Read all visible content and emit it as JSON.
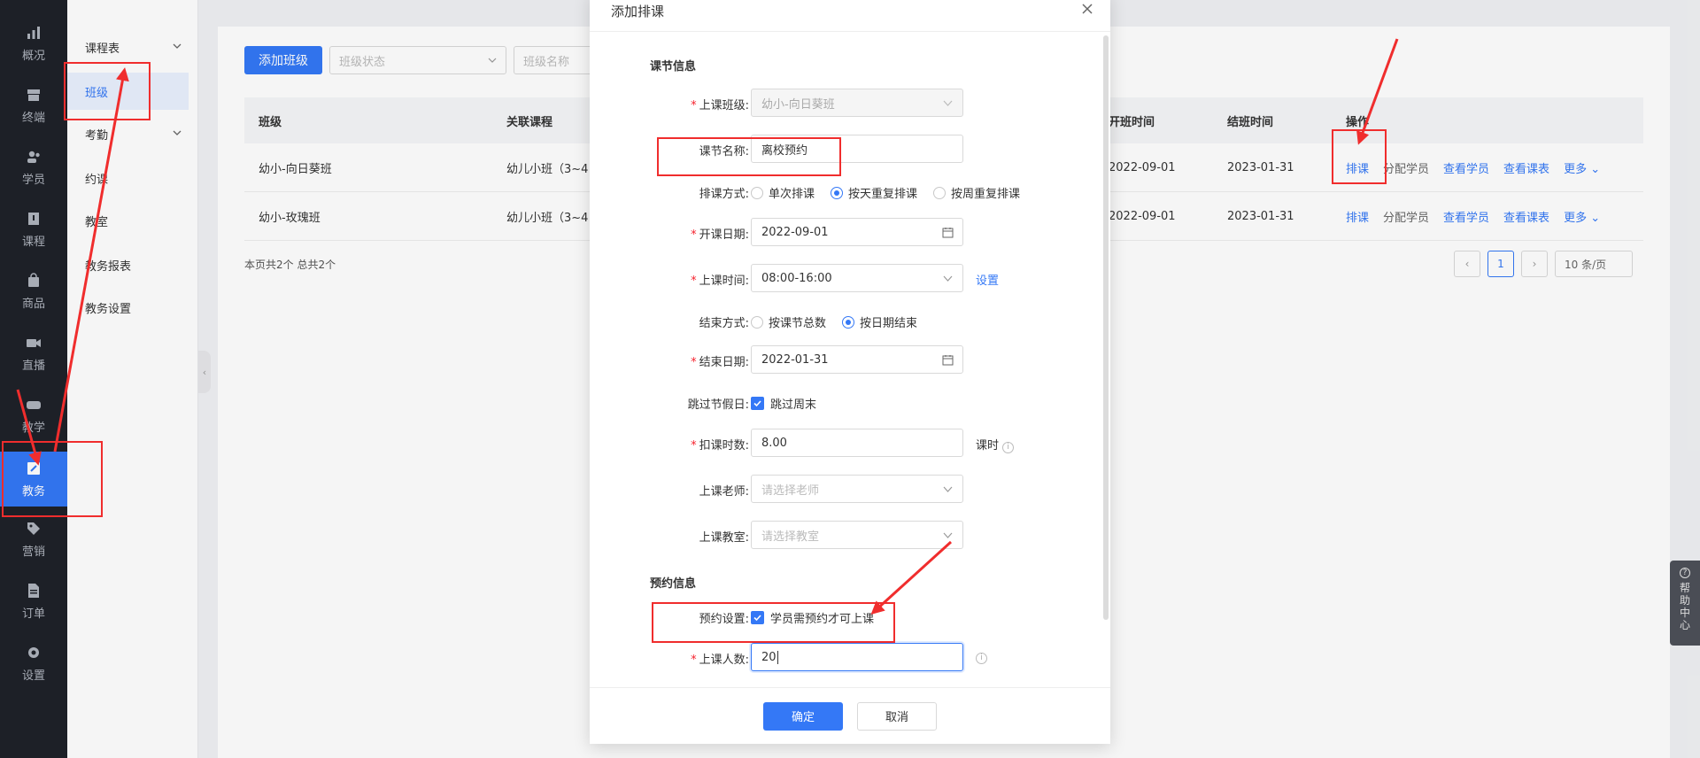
{
  "rail": {
    "items": [
      {
        "label": "概况",
        "icon": "chart-icon"
      },
      {
        "label": "终端",
        "icon": "shop-icon"
      },
      {
        "label": "学员",
        "icon": "users-icon"
      },
      {
        "label": "课程",
        "icon": "book-icon"
      },
      {
        "label": "商品",
        "icon": "bag-icon"
      },
      {
        "label": "直播",
        "icon": "video-icon"
      },
      {
        "label": "教学",
        "icon": "gamepad-icon"
      },
      {
        "label": "教务",
        "icon": "edit-icon"
      },
      {
        "label": "营销",
        "icon": "tag-icon"
      },
      {
        "label": "订单",
        "icon": "file-icon"
      },
      {
        "label": "设置",
        "icon": "gear-icon"
      }
    ],
    "active_index": 7
  },
  "submenu": {
    "items": [
      "课程表",
      "班级",
      "考勤",
      "约课",
      "教室",
      "教务报表",
      "教务设置"
    ]
  },
  "toolbar": {
    "add_class": "添加班级",
    "status_placeholder": "班级状态",
    "name_placeholder": "班级名称"
  },
  "table": {
    "headers": {
      "class": "班级",
      "course": "关联课程",
      "start": "开班时间",
      "end": "结班时间",
      "ops": "操作"
    },
    "rows": [
      {
        "class": "幼小-向日葵班",
        "course": "幼儿小班（3~4",
        "start": "2022-09-01",
        "end": "2023-01-31"
      },
      {
        "class": "幼小-玫瑰班",
        "course": "幼儿小班（3~4",
        "start": "2022-09-01",
        "end": "2023-01-31"
      }
    ],
    "ops": {
      "schedule": "排课",
      "assign": "分配学员",
      "view_students": "查看学员",
      "view_schedule": "查看课表",
      "more": "更多 ⌄"
    },
    "summary": "本页共2个 总共2个",
    "pager": {
      "current": "1",
      "prev": "‹",
      "next": "›",
      "size": "10 条/页"
    }
  },
  "modal": {
    "title": "添加排课",
    "section_lesson": "课节信息",
    "class_label": "上课班级:",
    "class_value": "幼小-向日葵班",
    "name_label": "课节名称:",
    "name_value": "离校预约",
    "mode_label": "排课方式:",
    "mode_options": [
      "单次排课",
      "按天重复排课",
      "按周重复排课"
    ],
    "mode_selected": 1,
    "start_label": "开课日期:",
    "start_value": "2022-09-01",
    "time_label": "上课时间:",
    "time_value": "08:00-16:00",
    "time_link": "设置",
    "end_mode_label": "结束方式:",
    "end_mode_options": [
      "按课节总数",
      "按日期结束"
    ],
    "end_mode_selected": 1,
    "end_label": "结束日期:",
    "end_value": "2022-01-31",
    "holiday_label": "跳过节假日:",
    "holiday_option": "跳过周末",
    "deduct_label": "扣课时数:",
    "deduct_value": "8.00",
    "deduct_unit": "课时",
    "teacher_label": "上课老师:",
    "teacher_placeholder": "请选择老师",
    "room_label": "上课教室:",
    "room_placeholder": "请选择教室",
    "section_booking": "预约信息",
    "booking_label": "预约设置:",
    "booking_option": "学员需预约才可上课",
    "count_label": "上课人数:",
    "count_value": "20",
    "ok": "确定",
    "cancel": "取消"
  },
  "help": {
    "text": [
      "帮",
      "助",
      "中",
      "心"
    ]
  },
  "colors": {
    "primary": "#3478f6",
    "annotation": "#f02d2d",
    "sidebar": "#1f2229"
  }
}
